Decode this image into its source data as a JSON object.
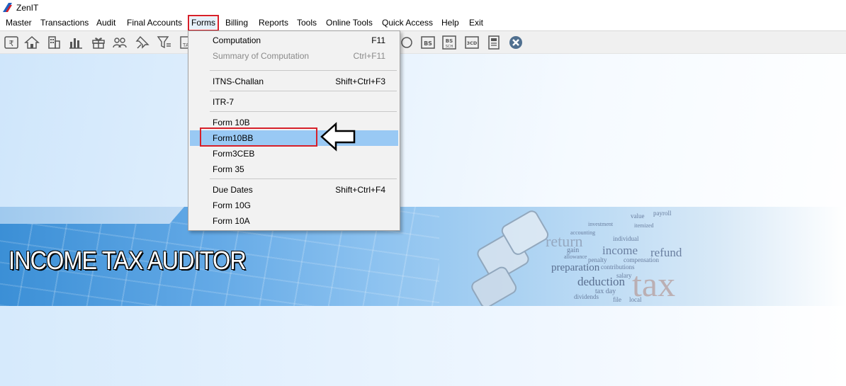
{
  "window": {
    "title": "ZenIT"
  },
  "menubar": {
    "items": [
      {
        "label": "Master",
        "active": false
      },
      {
        "label": "Transactions",
        "active": false
      },
      {
        "label": "Audit",
        "active": false
      },
      {
        "label": "Final Accounts",
        "active": false
      },
      {
        "label": "Forms",
        "active": true
      },
      {
        "label": "Billing",
        "active": false
      },
      {
        "label": "Reports",
        "active": false
      },
      {
        "label": "Tools",
        "active": false
      },
      {
        "label": "Online Tools",
        "active": false
      },
      {
        "label": "Quick Access",
        "active": false
      },
      {
        "label": "Help",
        "active": false
      },
      {
        "label": "Exit",
        "active": false
      }
    ]
  },
  "toolbar": {
    "icons": [
      "rupee-book-icon",
      "home-icon",
      "building-icon",
      "bar-chart-icon",
      "gift-icon",
      "users-icon",
      "pin-icon",
      "filter-icon",
      "ta-icon",
      "globe-icon",
      "bs-icon",
      "bs-sch-icon",
      "3cd-icon",
      "form-icon",
      "close-circle-icon"
    ],
    "text_icons": {
      "ta": "TA",
      "bs": "BS",
      "bs_sch_top": "BS",
      "bs_sch_bottom": "SCH",
      "cd": "3CD"
    }
  },
  "forms_menu": {
    "groups": [
      [
        {
          "label": "Computation",
          "shortcut": "F11",
          "disabled": false
        },
        {
          "label": "Summary of Computation",
          "shortcut": "Ctrl+F11",
          "disabled": true
        }
      ],
      [
        {
          "label": "ITNS-Challan",
          "shortcut": "Shift+Ctrl+F3",
          "disabled": false
        }
      ],
      [
        {
          "label": "ITR-7",
          "shortcut": "",
          "disabled": false
        }
      ],
      [
        {
          "label": "Form 10B",
          "shortcut": "",
          "disabled": false
        },
        {
          "label": "Form10BB",
          "shortcut": "",
          "disabled": false,
          "highlighted": true
        },
        {
          "label": "Form3CEB",
          "shortcut": "",
          "disabled": false
        },
        {
          "label": "Form 35",
          "shortcut": "",
          "disabled": false
        }
      ],
      [
        {
          "label": "Due Dates",
          "shortcut": "Shift+Ctrl+F4",
          "disabled": false
        },
        {
          "label": "Form 10G",
          "shortcut": "",
          "disabled": false
        },
        {
          "label": "Form 10A",
          "shortcut": "",
          "disabled": false
        }
      ]
    ]
  },
  "banner": {
    "title": "INCOME TAX AUDITOR",
    "word_cloud": [
      "value",
      "payroll",
      "investment",
      "itemized",
      "accounting",
      "return",
      "individual",
      "income",
      "refund",
      "gain",
      "penalty",
      "compensation",
      "preparation",
      "contributions",
      "salary",
      "deduction",
      "tax day",
      "dividends",
      "file",
      "local",
      "tax",
      "allowance"
    ]
  },
  "colors": {
    "highlight": "#99c9f4",
    "annotation_red": "#d6202a",
    "menu_bg": "#f2f2f2"
  }
}
